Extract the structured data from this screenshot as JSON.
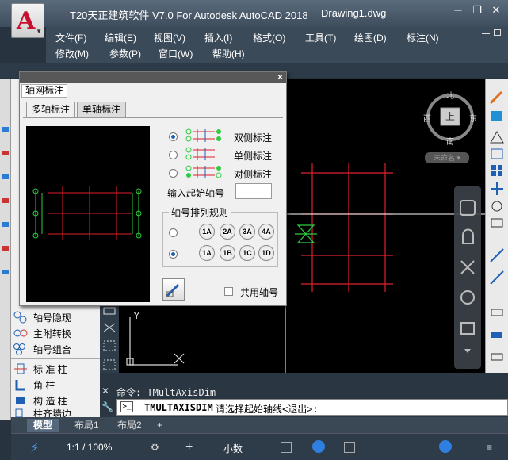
{
  "window": {
    "title": "T20天正建筑软件 V7.0 For Autodesk AutoCAD 2018",
    "doc_name": "Drawing1.dwg",
    "minimize": "─",
    "restore": "❐",
    "close": "✕"
  },
  "menubar": {
    "row1": [
      "文件(F)",
      "编辑(E)",
      "视图(V)",
      "插入(I)",
      "格式(O)",
      "工具(T)",
      "绘图(D)",
      "标注(N)"
    ],
    "row2": [
      "修改(M)",
      "参数(P)",
      "窗口(W)",
      "帮助(H)"
    ]
  },
  "left_palette": {
    "items": [
      "轴号隐现",
      "主附转换",
      "轴号组合",
      "标 准 柱",
      "角    柱",
      "构 造 柱",
      "柱齐墙边"
    ]
  },
  "dialog": {
    "title": "轴网标注",
    "close": "×",
    "tabs": [
      "多轴标注",
      "单轴标注"
    ],
    "mode_options": [
      "双侧标注",
      "单侧标注",
      "对侧标注"
    ],
    "selected_mode": 0,
    "start_label": "输入起始轴号",
    "start_value": "",
    "rule_group_label": "轴号排列规则",
    "rule_rows": [
      [
        "1A",
        "2A",
        "3A",
        "4A"
      ],
      [
        "1A",
        "1B",
        "1C",
        "1D"
      ]
    ],
    "selected_rule": 1,
    "shared_axis_label": "共用轴号",
    "shared_axis_checked": false
  },
  "viewcube": {
    "north": "北",
    "south": "南",
    "west": "西",
    "east": "东",
    "top": "上",
    "wcs": "未命名"
  },
  "command": {
    "history": "命令: TMultAxisDim",
    "command_name": "TMULTAXISDIM",
    "prompt": " 请选择起始轴线<退出>:"
  },
  "layout_tabs": [
    "模型",
    "布局1",
    "布局2",
    "+"
  ],
  "statusbar": {
    "scale": "1:1 / 100%",
    "units": "小数"
  },
  "colors": {
    "grid_red": "#e0202c",
    "axis_green": "#2ecc40",
    "canvas": "#000000",
    "accent": "#1f5fb4"
  }
}
